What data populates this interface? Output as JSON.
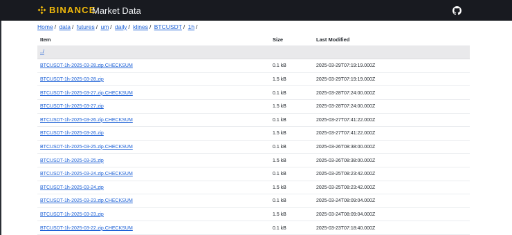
{
  "header": {
    "brand": "BINANCE",
    "title": "Market Data",
    "github_icon": "github-icon"
  },
  "breadcrumb": [
    {
      "label": "Home"
    },
    {
      "label": "data"
    },
    {
      "label": "futures"
    },
    {
      "label": "um"
    },
    {
      "label": "daily"
    },
    {
      "label": "klines"
    },
    {
      "label": "BTCUSDT"
    },
    {
      "label": "1h"
    }
  ],
  "table": {
    "headers": {
      "item": "Item",
      "size": "Size",
      "modified": "Last Modified"
    },
    "parent_link": "../",
    "rows": [
      {
        "name": "BTCUSDT-1h-2025-03-28.zip.CHECKSUM",
        "size": "0.1 kB",
        "modified": "2025-03-29T07:19:19.000Z"
      },
      {
        "name": "BTCUSDT-1h-2025-03-28.zip",
        "size": "1.5 kB",
        "modified": "2025-03-29T07:19:19.000Z"
      },
      {
        "name": "BTCUSDT-1h-2025-03-27.zip.CHECKSUM",
        "size": "0.1 kB",
        "modified": "2025-03-28T07:24:00.000Z"
      },
      {
        "name": "BTCUSDT-1h-2025-03-27.zip",
        "size": "1.5 kB",
        "modified": "2025-03-28T07:24:00.000Z"
      },
      {
        "name": "BTCUSDT-1h-2025-03-26.zip.CHECKSUM",
        "size": "0.1 kB",
        "modified": "2025-03-27T07:41:22.000Z"
      },
      {
        "name": "BTCUSDT-1h-2025-03-26.zip",
        "size": "1.5 kB",
        "modified": "2025-03-27T07:41:22.000Z"
      },
      {
        "name": "BTCUSDT-1h-2025-03-25.zip.CHECKSUM",
        "size": "0.1 kB",
        "modified": "2025-03-26T08:38:00.000Z"
      },
      {
        "name": "BTCUSDT-1h-2025-03-25.zip",
        "size": "1.5 kB",
        "modified": "2025-03-26T08:38:00.000Z"
      },
      {
        "name": "BTCUSDT-1h-2025-03-24.zip.CHECKSUM",
        "size": "0.1 kB",
        "modified": "2025-03-25T08:23:42.000Z"
      },
      {
        "name": "BTCUSDT-1h-2025-03-24.zip",
        "size": "1.5 kB",
        "modified": "2025-03-25T08:23:42.000Z"
      },
      {
        "name": "BTCUSDT-1h-2025-03-23.zip.CHECKSUM",
        "size": "0.1 kB",
        "modified": "2025-03-24T08:09:04.000Z"
      },
      {
        "name": "BTCUSDT-1h-2025-03-23.zip",
        "size": "1.5 kB",
        "modified": "2025-03-24T08:09:04.000Z"
      },
      {
        "name": "BTCUSDT-1h-2025-03-22.zip.CHECKSUM",
        "size": "0.1 kB",
        "modified": "2025-03-23T07:18:40.000Z"
      }
    ]
  },
  "colors": {
    "brand": "#f0b90b",
    "header_bg": "#181a20",
    "link": "#1a5fd6"
  }
}
